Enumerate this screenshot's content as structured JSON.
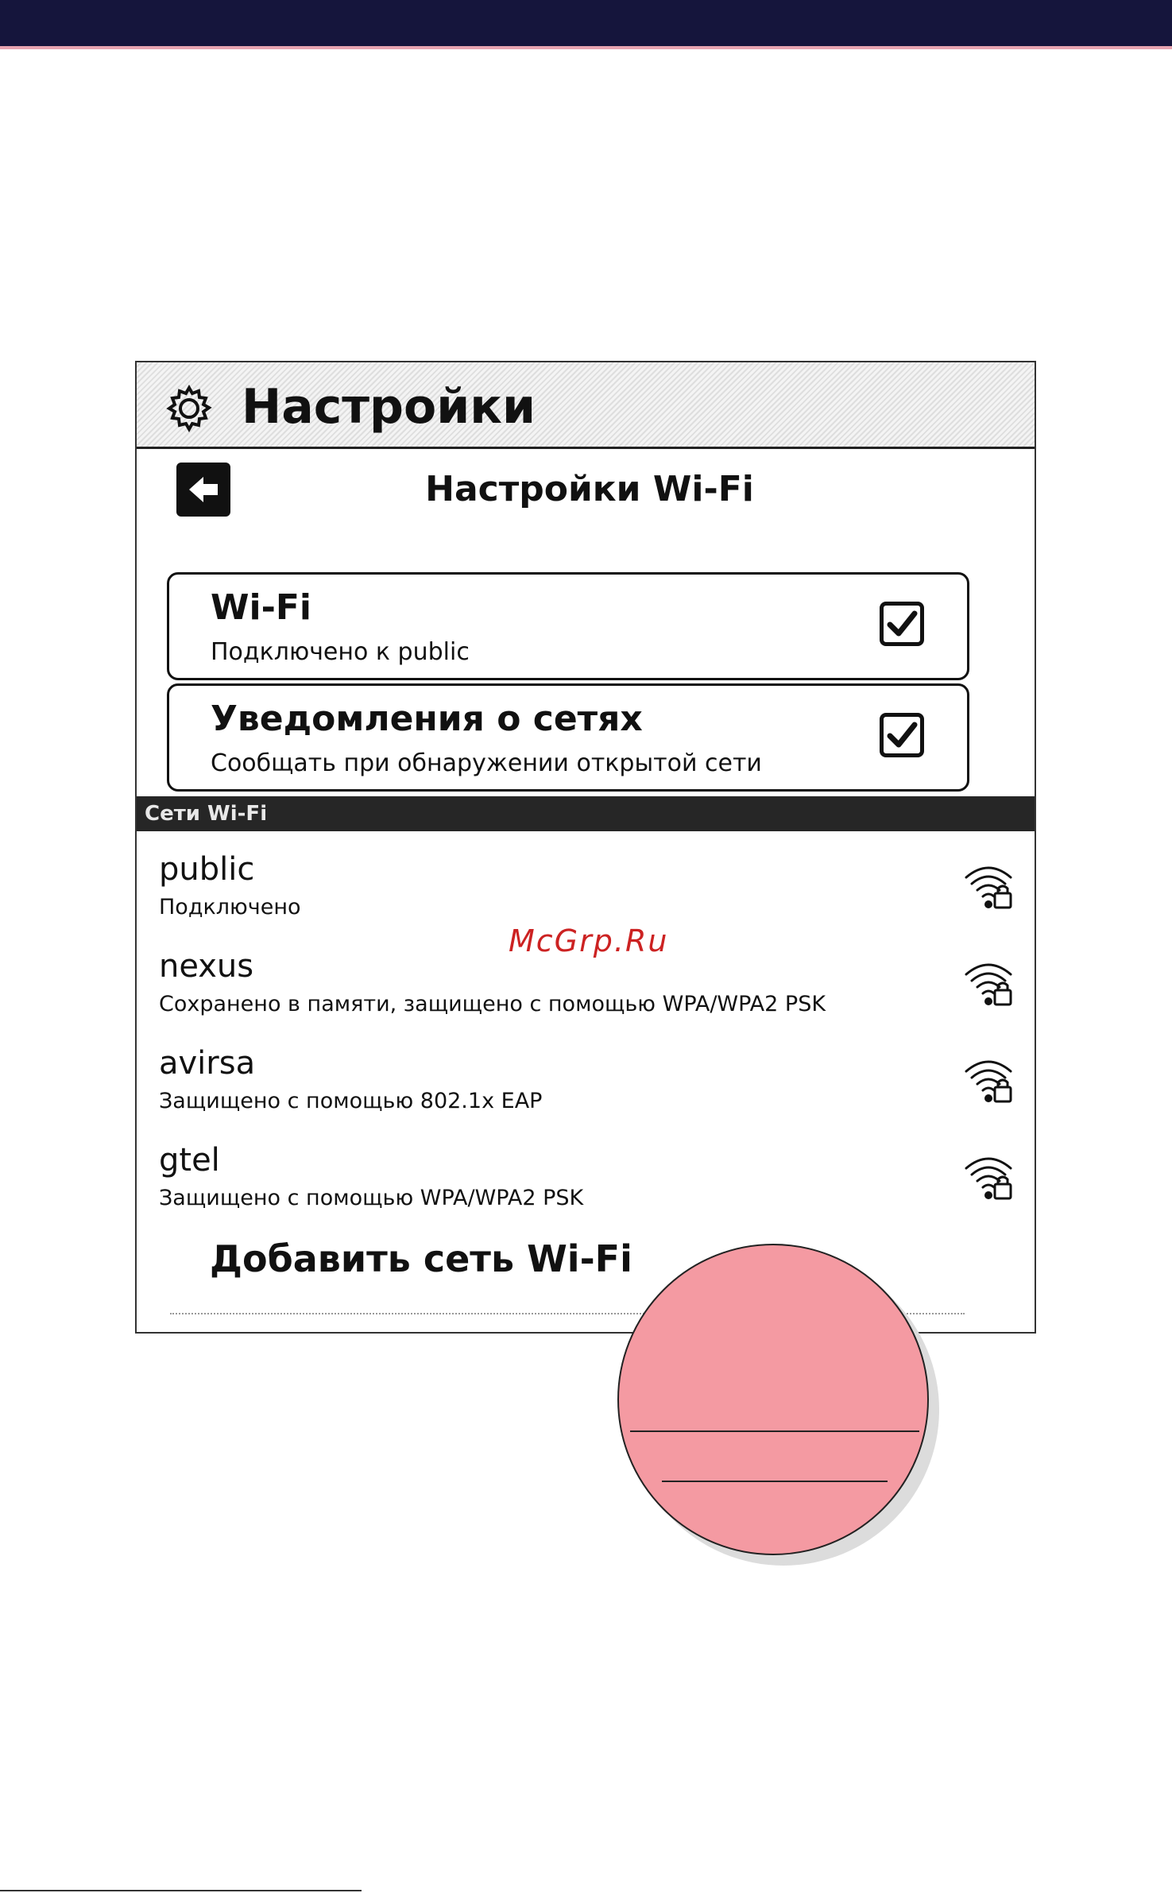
{
  "app": {
    "title": "Настройки",
    "icon": "gear-icon"
  },
  "page": {
    "title": "Настройки Wi-Fi",
    "back_icon": "arrow-left-icon"
  },
  "toggles": [
    {
      "title": "Wi-Fi",
      "subtitle": "Подключено к public",
      "checked": true
    },
    {
      "title": "Уведомления о сетях",
      "subtitle": "Сообщать при обнаружении открытой сети",
      "checked": true
    }
  ],
  "networks_section": {
    "header": "Сети Wi-Fi",
    "items": [
      {
        "name": "public",
        "status": "Подключено",
        "icon": "wifi-lock-icon"
      },
      {
        "name": "nexus",
        "status": "Сохранено в памяти, защищено с помощью WPA/WPA2 PSK",
        "icon": "wifi-lock-icon"
      },
      {
        "name": "avirsa",
        "status": "Защищено с помощью 802.1x EAP",
        "icon": "wifi-lock-icon"
      },
      {
        "name": "gtel",
        "status": "Защищено с помощью WPA/WPA2 PSK",
        "icon": "wifi-lock-icon"
      }
    ]
  },
  "add_network": {
    "label": "Добавить сеть Wi-Fi"
  },
  "watermark": "McGrp.Ru",
  "colors": {
    "top_bar": "#15153c",
    "top_bar_accent": "#e7a3b0",
    "section_header": "#262626",
    "circle_fill": "#f49aa2",
    "watermark": "#cc2222"
  }
}
